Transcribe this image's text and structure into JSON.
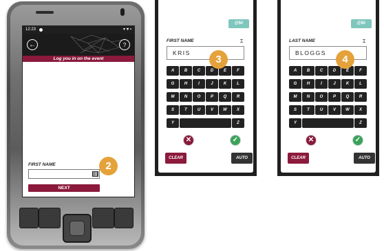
{
  "device": {
    "statusbar": {
      "time": "12:23",
      "icons": "▾ ♥ ▪"
    },
    "banner": "Log you in on the event",
    "field_label": "FIRST NAME",
    "field_value": "",
    "next_label": "NEXT",
    "back_icon": "back-arrow-icon",
    "help_icon": "question-icon",
    "keyboard_icon": "keyboard-icon"
  },
  "badges": {
    "step2": "2",
    "step3": "3",
    "step4": "4"
  },
  "panel_first": {
    "symbols_label": "@$#",
    "field_label": "FIRST NAME",
    "value": "KRIS",
    "clear_label": "CLEAR",
    "auto_label": "AUTO"
  },
  "panel_last": {
    "symbols_label": "@$#",
    "field_label": "LAST NAME",
    "value": "BLOGGS",
    "clear_label": "CLEAR",
    "auto_label": "AUTO"
  },
  "keyboard_rows": [
    [
      "A",
      "B",
      "C",
      "D",
      "E",
      "F"
    ],
    [
      "G",
      "H",
      "I",
      "J",
      "K",
      "L"
    ],
    [
      "M",
      "N",
      "O",
      "P",
      "Q",
      "R"
    ],
    [
      "S",
      "T",
      "U",
      "V",
      "W",
      "X"
    ],
    [
      "Y",
      "",
      "",
      "",
      "",
      "Z"
    ]
  ],
  "colors": {
    "brand": "#8b1a3d",
    "badge": "#e5a23a",
    "accent": "#7fc6bd",
    "ok": "#3aa35a"
  }
}
